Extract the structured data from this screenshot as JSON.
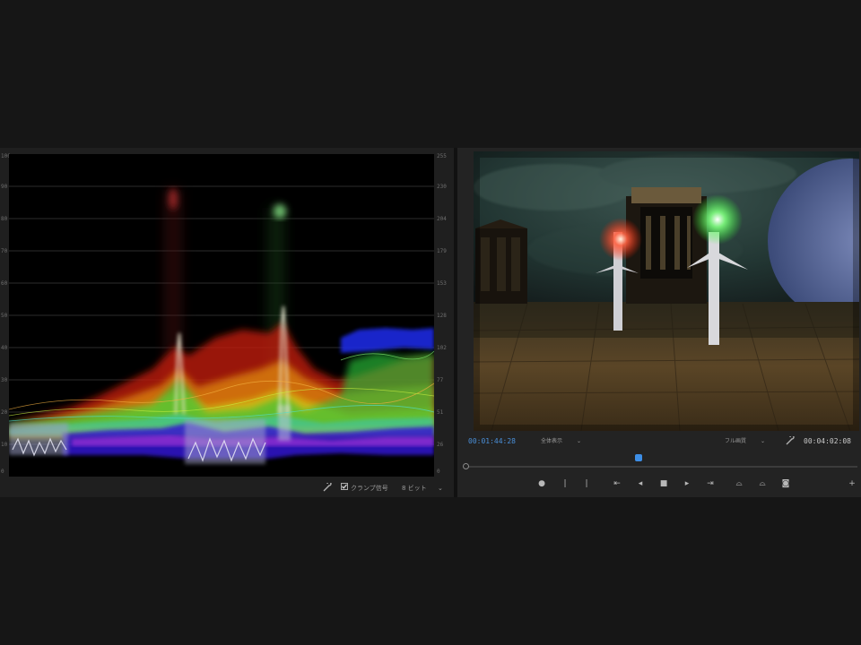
{
  "scope": {
    "scale_left": [
      "100",
      "90",
      "80",
      "70",
      "60",
      "50",
      "40",
      "30",
      "20",
      "10",
      "0"
    ],
    "scale_right": [
      "255",
      "230",
      "204",
      "179",
      "153",
      "128",
      "102",
      "77",
      "51",
      "26",
      "0"
    ],
    "footer": {
      "checkbox_label": "クランプ信号",
      "bit_depth_label": "8 ビット",
      "dropdown_arrow": "⌄"
    }
  },
  "monitor": {
    "timecode_current": "00:01:44:28",
    "fit_label": "全体表示",
    "quality_label": "フル画質",
    "timecode_duration": "00:04:02:08",
    "dropdown_arrow": "⌄"
  },
  "transport": {
    "marker": "●",
    "in": "❘",
    "out": "❘",
    "go_in": "⇤",
    "step_back": "◂",
    "stop": "■",
    "step_forward": "▸",
    "go_out": "⇥",
    "lift": "⌓",
    "extract": "⌓",
    "export_frame": "◙",
    "add": "+"
  },
  "colors": {
    "accent_blue": "#3d8ee6",
    "panel_bg": "#232323",
    "scope_bg": "#000000"
  }
}
